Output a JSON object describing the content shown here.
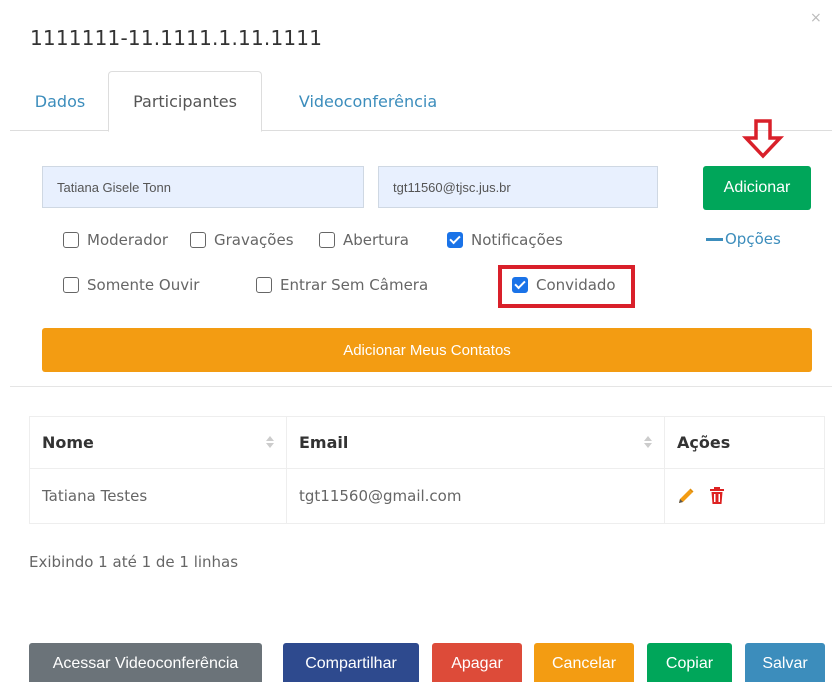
{
  "modal": {
    "title": "1111111-11.1111.1.11.1111",
    "close_label": "×"
  },
  "tabs": [
    {
      "label": "Dados"
    },
    {
      "label": "Participantes"
    },
    {
      "label": "Videoconferência"
    }
  ],
  "form": {
    "name_value": "Tatiana Gisele Tonn",
    "email_value": "tgt11560@tjsc.jus.br",
    "add_label": "Adicionar",
    "options_label": "Opções",
    "checkboxes": [
      {
        "label": "Moderador",
        "checked": false
      },
      {
        "label": "Gravações",
        "checked": false
      },
      {
        "label": "Abertura",
        "checked": false
      },
      {
        "label": "Notificações",
        "checked": true
      },
      {
        "label": "Somente Ouvir",
        "checked": false
      },
      {
        "label": "Entrar Sem Câmera",
        "checked": false
      },
      {
        "label": "Convidado",
        "checked": true
      }
    ],
    "contacts_label": "Adicionar Meus Contatos"
  },
  "table": {
    "headers": [
      "Nome",
      "Email",
      "Ações"
    ],
    "rows": [
      {
        "name": "Tatiana Testes",
        "email": "tgt11560@gmail.com"
      }
    ],
    "footer": "Exibindo 1 até 1 de 1 linhas"
  },
  "buttons": {
    "access": "Acessar Videoconferência",
    "share": "Compartilhar",
    "delete": "Apagar",
    "cancel": "Cancelar",
    "copy": "Copiar",
    "save": "Salvar"
  },
  "icons": {
    "edit": "pencil-icon",
    "delete": "trash-icon",
    "annotation": "down-arrow-icon"
  },
  "colors": {
    "green": "#00a65a",
    "orange": "#f39c12",
    "blue": "#3c8dbc",
    "red": "#dd4b39",
    "navy": "#2e4a8e",
    "gray": "#6b7379",
    "highlight": "#d9202a"
  }
}
